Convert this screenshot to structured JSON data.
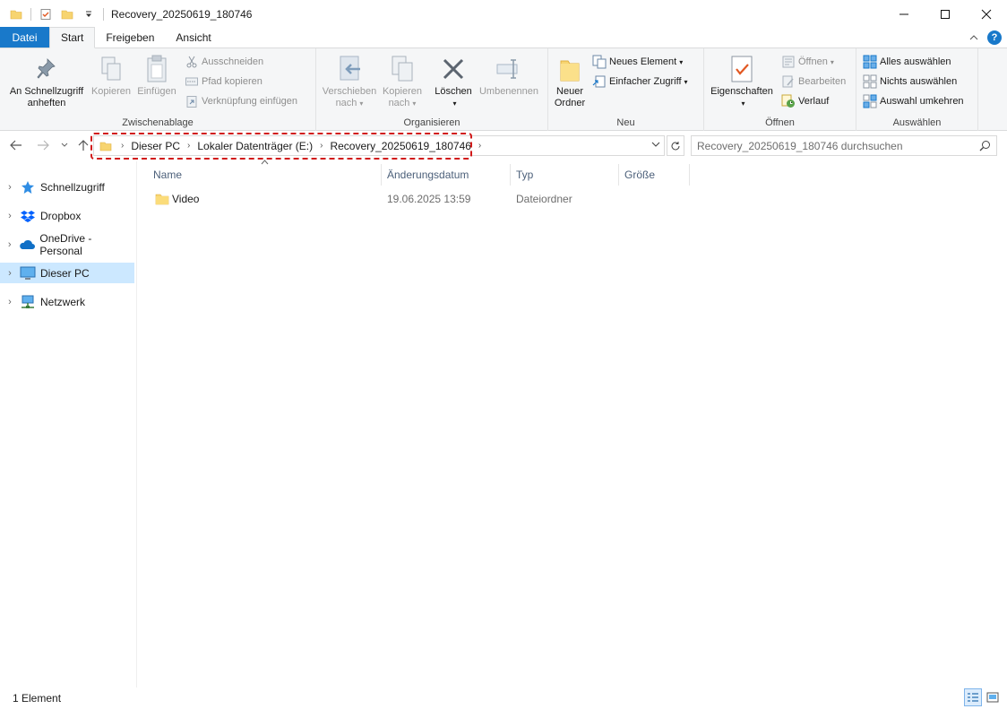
{
  "window": {
    "title": "Recovery_20250619_180746",
    "controls": {
      "minimize": "—",
      "maximize": "☐",
      "close": "✕"
    }
  },
  "tabs": [
    {
      "label": "Datei"
    },
    {
      "label": "Start"
    },
    {
      "label": "Freigeben"
    },
    {
      "label": "Ansicht"
    }
  ],
  "ribbon": {
    "clipboard": {
      "label": "Zwischenablage",
      "pin_line1": "An Schnellzugriff",
      "pin_line2": "anheften",
      "copy": "Kopieren",
      "paste": "Einfügen",
      "cut": "Ausschneiden",
      "copy_path": "Pfad kopieren",
      "paste_shortcut": "Verknüpfung einfügen"
    },
    "organize": {
      "label": "Organisieren",
      "move_line1": "Verschieben",
      "move_line2": "nach",
      "copyto_line1": "Kopieren",
      "copyto_line2": "nach",
      "delete": "Löschen",
      "rename": "Umbenennen"
    },
    "new": {
      "label": "Neu",
      "new_folder_line1": "Neuer",
      "new_folder_line2": "Ordner",
      "new_item": "Neues Element",
      "easy_access": "Einfacher Zugriff"
    },
    "open": {
      "label": "Öffnen",
      "properties": "Eigenschaften",
      "open": "Öffnen",
      "edit": "Bearbeiten",
      "history": "Verlauf"
    },
    "select": {
      "label": "Auswählen",
      "select_all": "Alles auswählen",
      "select_none": "Nichts auswählen",
      "invert": "Auswahl umkehren"
    }
  },
  "address": {
    "crumbs": [
      "Dieser PC",
      "Lokaler Datenträger (E:)",
      "Recovery_20250619_180746"
    ],
    "search_placeholder": "Recovery_20250619_180746 durchsuchen"
  },
  "nav": {
    "items": [
      {
        "label": "Schnellzugriff",
        "icon": "star-icon"
      },
      {
        "label": "Dropbox",
        "icon": "dropbox-icon"
      },
      {
        "label": "OneDrive - Personal",
        "icon": "cloud-icon"
      },
      {
        "label": "Dieser PC",
        "icon": "computer-icon",
        "selected": true
      },
      {
        "label": "Netzwerk",
        "icon": "network-icon"
      }
    ]
  },
  "columns": [
    "Name",
    "Änderungsdatum",
    "Typ",
    "Größe"
  ],
  "files": [
    {
      "name": "Video",
      "modified": "19.06.2025 13:59",
      "type": "Dateiordner",
      "size": ""
    }
  ],
  "status": {
    "count": "1 Element"
  },
  "colors": {
    "accent": "#1979ca",
    "selected": "#cce8ff",
    "highlight": "#d11a1a",
    "folder": "#f7d470"
  }
}
